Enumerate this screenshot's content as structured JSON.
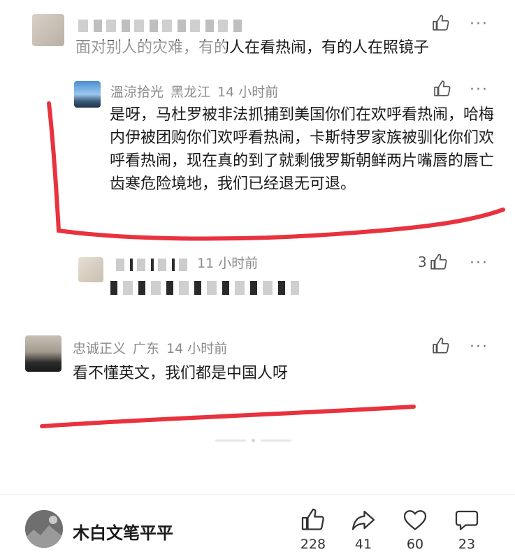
{
  "comments": [
    {
      "id": "top_partial",
      "body": "面对别人的灾难，有的人在看热闹，有的人在照镜子"
    },
    {
      "id": "reply1",
      "username": "溫涼拾光",
      "location": "黑龙江",
      "time": "14 小时前",
      "body": "是呀，马杜罗被非法抓捕到美国你们在欢呼看热闹，哈梅内伊被团购你们欢呼看热闹，卡斯特罗家族被驯化你们欢呼看热闹，现在真的到了就剩俄罗斯朝鲜两片嘴唇的唇亡齿寒危险境地，我们已经退无可退。"
    },
    {
      "id": "reply2",
      "time": "11 小时前",
      "likes": "3"
    },
    {
      "id": "comment3",
      "username": "忠诚正义",
      "location": "广东",
      "time": "14 小时前",
      "body": "看不懂英文，我们都是中国人呀"
    }
  ],
  "icons": {
    "like": "thumbs-up-icon",
    "more": "more-dots-icon",
    "share": "share-arrow-icon",
    "heart": "heart-icon",
    "comment": "comment-bubble-icon"
  },
  "more_glyph": "···",
  "annotation_color": "#e8323e",
  "footer": {
    "author_name": "木白文笔平平",
    "likes": "228",
    "shares": "41",
    "favorites": "60",
    "comments": "23"
  }
}
